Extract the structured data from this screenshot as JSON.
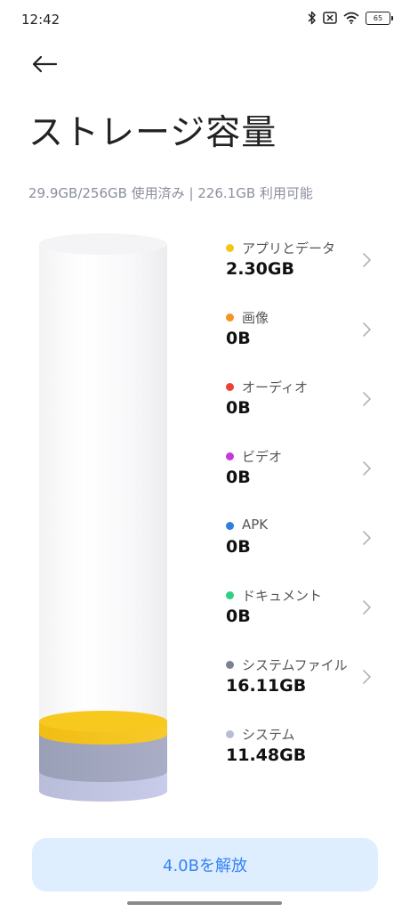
{
  "status_bar": {
    "time": "12:42",
    "battery": "65"
  },
  "header": {
    "back_icon": "arrow-left-icon",
    "title": "ストレージ容量"
  },
  "summary": {
    "text": "29.9GB/256GB 使用済み | 226.1GB 利用可能"
  },
  "categories": [
    {
      "label": "アプリとデータ",
      "value": "2.30GB",
      "color": "#f5c518",
      "chevron": true
    },
    {
      "label": "画像",
      "value": "0B",
      "color": "#f59322",
      "chevron": true
    },
    {
      "label": "オーディオ",
      "value": "0B",
      "color": "#ee4036",
      "chevron": true
    },
    {
      "label": "ビデオ",
      "value": "0B",
      "color": "#c23ad8",
      "chevron": true
    },
    {
      "label": "APK",
      "value": "0B",
      "color": "#2d7ee0",
      "chevron": true
    },
    {
      "label": "ドキュメント",
      "value": "0B",
      "color": "#2fcf84",
      "chevron": true
    },
    {
      "label": "システムファイル",
      "value": "16.11GB",
      "color": "#7a8196",
      "chevron": true
    },
    {
      "label": "システム",
      "value": "11.48GB",
      "color": "#b7bdd6",
      "chevron": false
    }
  ],
  "free_button": {
    "label": "4.0Bを解放"
  }
}
